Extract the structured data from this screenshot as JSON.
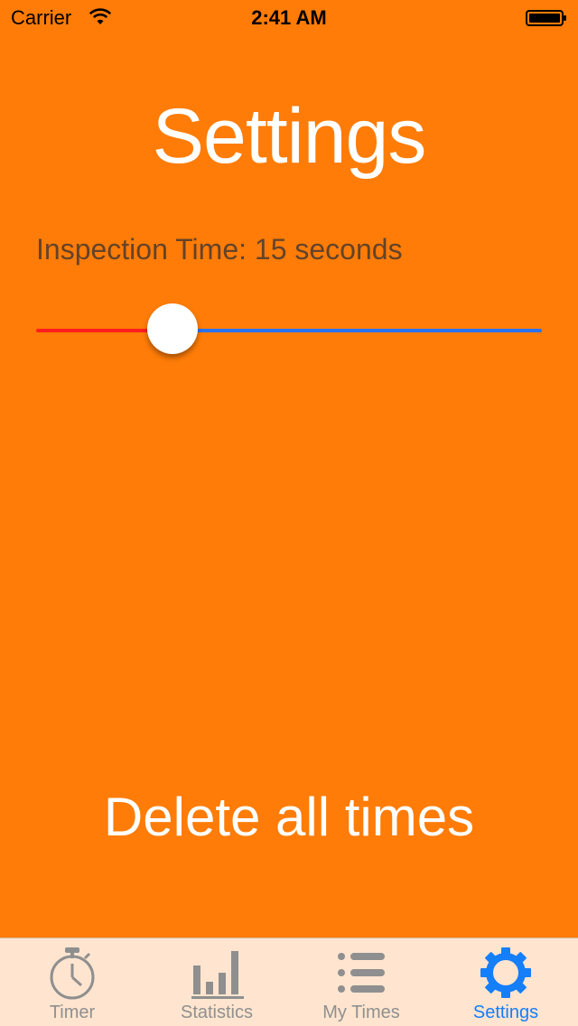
{
  "status_bar": {
    "carrier": "Carrier",
    "time": "2:41 AM"
  },
  "settings": {
    "title": "Settings",
    "inspection_label": "Inspection Time: 15 seconds",
    "slider": {
      "value_fraction": 0.27,
      "min_color": "#ff1e1e",
      "max_color": "#2b72f0"
    },
    "delete_label": "Delete all times"
  },
  "tab_bar": {
    "active_color": "#157ef9",
    "inactive_color": "#8f8f8f",
    "tabs": [
      {
        "label": "Timer",
        "icon": "stopwatch-icon"
      },
      {
        "label": "Statistics",
        "icon": "bar-chart-icon"
      },
      {
        "label": "My Times",
        "icon": "list-icon"
      },
      {
        "label": "Settings",
        "icon": "gear-icon",
        "active": true
      }
    ]
  },
  "colors": {
    "background": "#fe7c07",
    "tab_bar_background": "#ffe5cf"
  }
}
